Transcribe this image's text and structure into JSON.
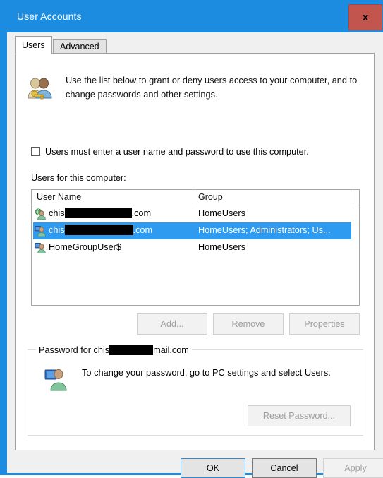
{
  "window": {
    "title": "User Accounts",
    "close_label": "x",
    "titlebar_color": "#1b8ce0",
    "close_color": "#c2564f"
  },
  "tabs": [
    {
      "label": "Users",
      "active": true
    },
    {
      "label": "Advanced",
      "active": false
    }
  ],
  "header": {
    "icon": "two-users-key-icon",
    "text": "Use the list below to grant or deny users access to your computer, and to change passwords and other settings."
  },
  "require_password_checkbox": {
    "label": "Users must enter a user name and password to use this computer.",
    "checked": false
  },
  "users_list": {
    "label": "Users for this computer:",
    "columns": [
      "User Name",
      "Group"
    ],
    "rows": [
      {
        "icon": "user-globe-icon",
        "name_prefix": "chis",
        "redacted_width": 95,
        "name_suffix": ".com",
        "group": "HomeUsers",
        "selected": false
      },
      {
        "icon": "user-monitor-icon",
        "name_prefix": "chis",
        "redacted_width": 97,
        "name_suffix": ".com",
        "group": "HomeUsers; Administrators; Us...",
        "selected": true
      },
      {
        "icon": "user-monitor-icon",
        "name_prefix": "HomeGroupUser$",
        "redacted_width": 0,
        "name_suffix": "",
        "group": "HomeUsers",
        "selected": false
      }
    ],
    "selection_color": "#2f9bf0"
  },
  "list_buttons": {
    "add": "Add...",
    "remove": "Remove",
    "properties": "Properties"
  },
  "password_group": {
    "legend_prefix": "Password for chis",
    "legend_redacted_width": 62,
    "legend_suffix": "mail.com",
    "icon": "user-monitor-icon",
    "text": "To change your password, go to PC settings and select Users.",
    "reset_button": "Reset Password..."
  },
  "footer": {
    "ok": "OK",
    "cancel": "Cancel",
    "apply": "Apply"
  }
}
